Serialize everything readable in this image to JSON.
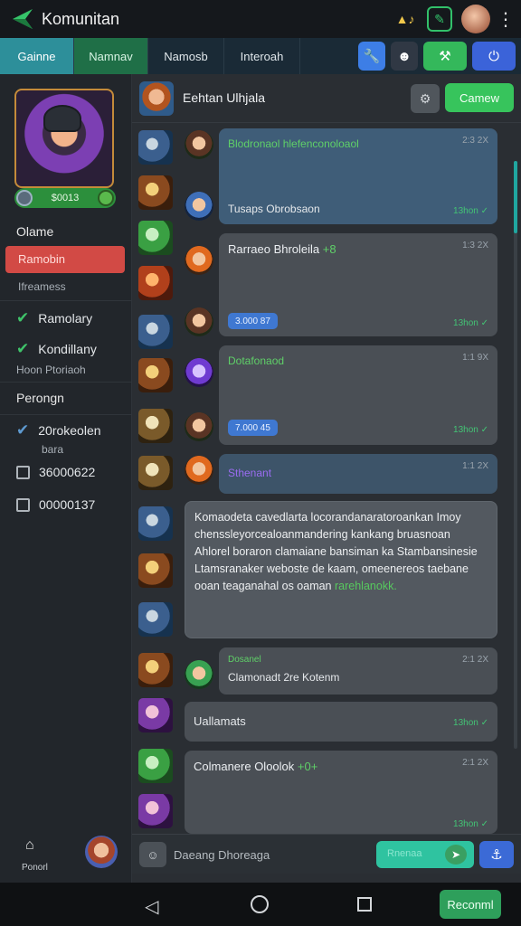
{
  "app": {
    "title": "Komunitan"
  },
  "tabs": [
    "Gainne",
    "Namnav",
    "Namosb",
    "Interoah"
  ],
  "sidebar": {
    "level": "$0013",
    "section1": "Olame",
    "active_item": "Ramobin",
    "sub_label": "Ifreamess",
    "items": [
      {
        "label": "Ramolary"
      },
      {
        "label": "Kondillany"
      }
    ],
    "sub_label2": "Hoon Ptoriaoh",
    "section2": "Perongn",
    "entries": [
      {
        "label": "20rokeolen",
        "sub": "bara"
      },
      {
        "label": "36000622"
      },
      {
        "label": "00000137"
      }
    ],
    "home_label": "Ponorl"
  },
  "chat": {
    "title": "Eehtan Ulhjala",
    "action_button": "Camew",
    "messages": [
      {
        "name": "Blodronaol hlefenconoloaol",
        "time": "2:3 2X",
        "text": "Tusaps Obrobsaon",
        "tick": "13hon ✓"
      },
      {
        "name": "Rarraeo Bhroleila",
        "badge": "+8",
        "time": "1:3 2X",
        "pill": "3.000 87",
        "tick": "13hon ✓"
      },
      {
        "name": "Dotafonaod",
        "time": "1:1 9X",
        "pill": "7.000 45",
        "tick": "13hon ✓"
      },
      {
        "name": "Sthenant",
        "time": "1:1 2X"
      },
      {
        "long_text": "Komaodeta cavedlarta locorandanaratoroankan Imoy chenssleyorcealoanmandering kankang bruasnoan Ahlorel boraron clamaiane bansiman ka Stambansinesie Ltamsranaker weboste de kaam, omeenereos taebane ooan teaganahal os oaman",
        "long_text_green": "rarehlanokk."
      },
      {
        "name": "Dosanel",
        "time": "2:1 2X",
        "text": "Clamonadt 2re Kotenm"
      },
      {
        "name": "Uallamats",
        "tick": "13hon ✓"
      },
      {
        "name": "Colmanere Oloolok",
        "badge": "+0+",
        "time": "2:1 2X",
        "tick": "13hon ✓"
      }
    ]
  },
  "input": {
    "placeholder": "Daeang Dhoreaga",
    "send_label": "Rnenaa"
  },
  "navbar": {
    "button": "Reconml"
  }
}
